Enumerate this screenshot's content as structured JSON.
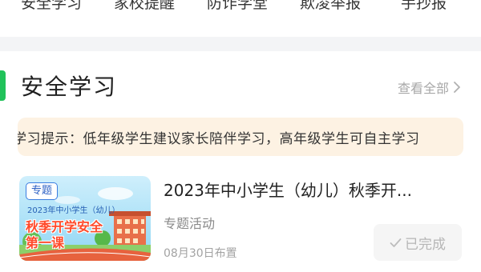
{
  "top_nav": {
    "items": [
      {
        "label": "安全学习"
      },
      {
        "label": "家校提醒"
      },
      {
        "label": "防诈学堂"
      },
      {
        "label": "欺凌举报"
      },
      {
        "label": "手抄报"
      }
    ]
  },
  "section": {
    "title": "安全学习",
    "see_all_label": "查看全部",
    "accent_color": "#21c25a",
    "notice_text": "学习提示：低年级学生建议家长陪伴学习，高年级学生可自主学习"
  },
  "item": {
    "thumb": {
      "tag": "专题",
      "subtitle": "2023年中小学生（幼儿）",
      "headline_line1": "秋季开学安全",
      "headline_line2": "第一课"
    },
    "title": "2023年中小学生（幼儿）秋季开...",
    "type_label": "专题活动",
    "date_label": "08月30日布置",
    "status_label": "已完成"
  }
}
